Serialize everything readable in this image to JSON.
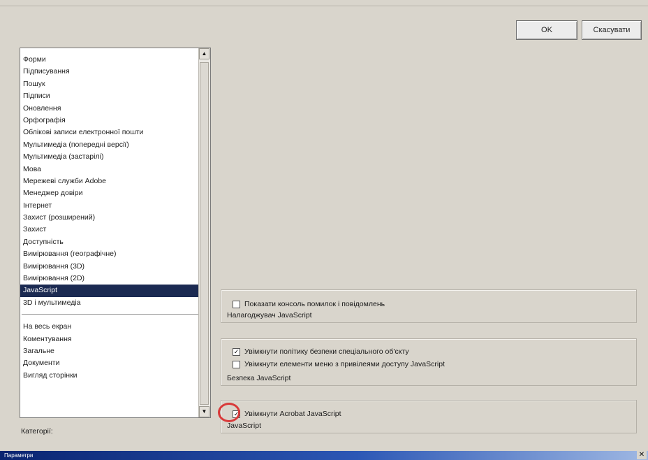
{
  "buttons": {
    "ok": "OK",
    "cancel": "Скасувати"
  },
  "categories": {
    "items": [
      "Форми",
      "Підписування",
      "Пошук",
      "Підписи",
      "Оновлення",
      "Орфографія",
      "Облікові записи електронної пошти",
      "Мультимедіа (попередні версії)",
      "Мультимедіа (застарілі)",
      "Мова",
      "Мережеві служби Adobe",
      "Менеджер довіри",
      "Інтернет",
      "Захист (розширений)",
      "Захист",
      "Доступність",
      "Вимірювання (географічне)",
      "Вимірювання (3D)",
      "Вимірювання (2D)",
      "JavaScript",
      "3D і мультимедіа"
    ],
    "selected": "JavaScript",
    "pinned_items": [
      "На весь екран",
      "Коментування",
      "Загальне",
      "Документи",
      "Вигляд сторінки"
    ],
    "label": "Категорії:"
  },
  "groups": {
    "debugger": {
      "legend": "Налагоджувач JavaScript",
      "options": [
        {
          "label": "Показати консоль помилок і повідомлень",
          "checked": false
        }
      ]
    },
    "security": {
      "legend": "Безпека JavaScript",
      "options": [
        {
          "label": "Увімкнути політику безпеки спеціального об'єкту",
          "checked": true
        },
        {
          "label": "Увімкнути елементи меню з привілеями доступу JavaScript",
          "checked": false
        }
      ]
    },
    "javascript": {
      "legend": "JavaScript",
      "options": [
        {
          "label": "Увімкнути Acrobat JavaScript",
          "checked": true
        }
      ]
    }
  },
  "title_bar": {
    "title": "Параметри",
    "close": "✕"
  },
  "accent_colors": {
    "selection": "#1b2a52",
    "highlight_ring": "#d93a3a"
  }
}
